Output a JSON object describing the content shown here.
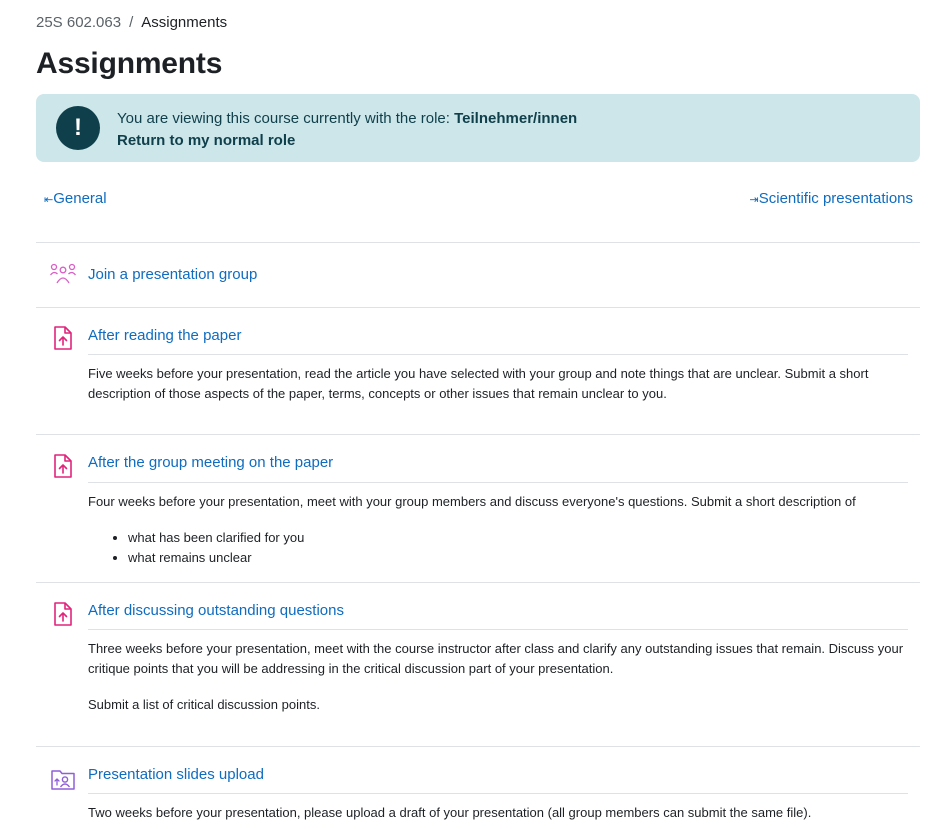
{
  "breadcrumb": {
    "course": "25S 602.063",
    "separator": "/",
    "current": "Assignments"
  },
  "page_title": "Assignments",
  "role_alert": {
    "message": "You are viewing this course currently with the role: ",
    "role": "Teilnehmer/innen",
    "return_label": "Return to my normal role",
    "icon": "exclamation-icon"
  },
  "section_nav": {
    "prev_label": "General",
    "next_label": "Scientific presentations"
  },
  "activities": [
    {
      "title": "Join a presentation group",
      "icon": "group-choice-icon",
      "description": []
    },
    {
      "title": "After reading the paper",
      "icon": "assignment-upload-icon",
      "description": [
        "Five weeks before your presentation, read the article you have selected with your group and note things that are unclear. Submit a short description of those aspects of the paper, terms, concepts or other issues that remain unclear to you."
      ]
    },
    {
      "title": "After the group meeting on the paper",
      "icon": "assignment-upload-icon",
      "description": [
        "Four weeks before your presentation, meet with your group members and discuss everyone's questions. Submit a short description of"
      ],
      "bullets": [
        "what has been clarified for you",
        "what remains unclear"
      ]
    },
    {
      "title": "After discussing outstanding questions",
      "icon": "assignment-upload-icon",
      "description": [
        "Three weeks before your presentation, meet with the course instructor after class and clarify any outstanding issues that remain. Discuss your critique points that you will be addressing in the critical discussion part of your presentation.",
        "Submit a list of critical discussion points."
      ]
    },
    {
      "title": "Presentation slides upload",
      "icon": "folder-upload-icon",
      "description": [
        "Two weeks before your presentation, please upload a draft of your presentation (all group members can submit the same file)."
      ]
    }
  ],
  "colors": {
    "link": "#0f6cbf",
    "alert_bg": "#cce6ea",
    "alert_text": "#0f3f4b",
    "assignment_icon": "#e1247c",
    "choice_icon": "#d95fc5",
    "folder_icon": "#8f5fd8",
    "divider": "#dee2e6"
  }
}
